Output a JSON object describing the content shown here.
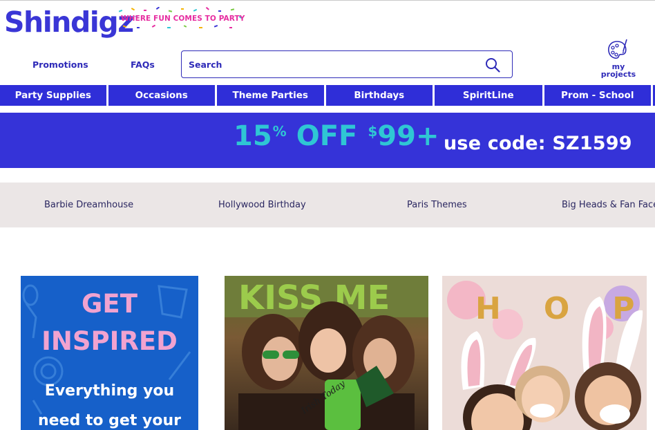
{
  "brand": {
    "logo": "Shindigz",
    "trademark": "™",
    "tagline": "WHERE FUN COMES TO PARTY"
  },
  "utility_links": {
    "promotions": "Promotions",
    "faqs": "FAQs"
  },
  "search": {
    "placeholder": "Search"
  },
  "my_projects": {
    "line1": "my",
    "line2": "projects"
  },
  "nav": {
    "items": [
      {
        "label": "Party Supplies"
      },
      {
        "label": "Occasions"
      },
      {
        "label": "Theme Parties"
      },
      {
        "label": "Birthdays"
      },
      {
        "label": "SpiritLine"
      },
      {
        "label": "Prom - School"
      }
    ]
  },
  "promo_banner": {
    "percent": "15",
    "percent_sign": "%",
    "off": "OFF",
    "dollar_sign": "$",
    "amount": "99+",
    "code_text": "use code: SZ1599"
  },
  "themes": {
    "items": [
      {
        "label": "Barbie Dreamhouse"
      },
      {
        "label": "Hollywood Birthday"
      },
      {
        "label": "Paris Themes"
      },
      {
        "label": "Big Heads & Fan Faces"
      }
    ]
  },
  "cards": {
    "inspire": {
      "title_line1": "GET",
      "title_line2": "INSPIRED",
      "sub_line1": "Everything you",
      "sub_line2": "need to get your"
    },
    "stpatricks": {
      "sign": "KISS ME",
      "prop_text": "Irish Today"
    },
    "easter": {
      "balloons": "HOP"
    }
  },
  "colors": {
    "brand_blue": "#3a36d6",
    "nav_blue": "#2f2ed8",
    "banner_blue": "#3533d8",
    "promo_teal": "#2fc6d4",
    "tagline_pink": "#e62da0",
    "theme_strip_bg": "#ebe6e6",
    "inspire_bg": "#1660c9",
    "inspire_pink": "#f1a3d0"
  }
}
